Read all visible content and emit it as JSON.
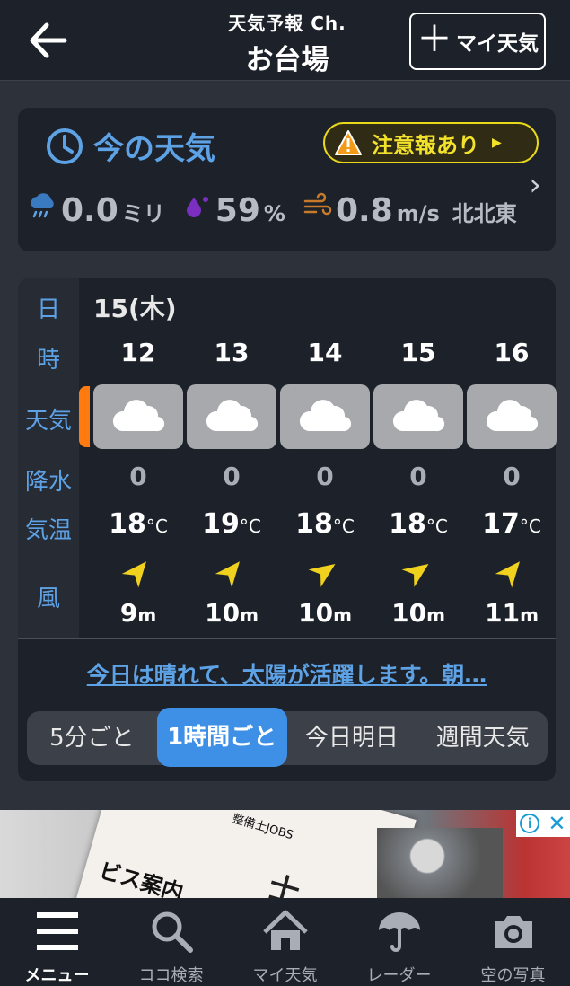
{
  "header": {
    "subtitle": "天気予報 Ch.",
    "title": "お台場",
    "my_weather_button": "マイ天気"
  },
  "now": {
    "title": "今の天気",
    "alert_label": "注意報あり",
    "precip_value": "0.0",
    "precip_unit": "ミリ",
    "humidity_value": "59",
    "humidity_unit": "%",
    "wind_value": "0.8",
    "wind_unit": "m/s",
    "wind_dir": "北北東"
  },
  "forecast": {
    "labels": {
      "day": "日",
      "hour": "時",
      "weather": "天気",
      "precip": "降水",
      "temp": "気温",
      "wind": "風"
    },
    "date": "15(木)",
    "hours": [
      {
        "hour": "12",
        "weather": "cloudy-icon",
        "precip": "0",
        "temp": "18",
        "wind_speed": "9",
        "wind_dir_deg": 40
      },
      {
        "hour": "13",
        "weather": "cloudy-icon",
        "precip": "0",
        "temp": "19",
        "wind_speed": "10",
        "wind_dir_deg": 40
      },
      {
        "hour": "14",
        "weather": "cloudy-icon",
        "precip": "0",
        "temp": "18",
        "wind_speed": "10",
        "wind_dir_deg": 55
      },
      {
        "hour": "15",
        "weather": "cloudy-icon",
        "precip": "0",
        "temp": "18",
        "wind_speed": "10",
        "wind_dir_deg": 55
      },
      {
        "hour": "16",
        "weather": "cloudy-icon",
        "precip": "0",
        "temp": "17",
        "wind_speed": "11",
        "wind_dir_deg": 40
      }
    ],
    "temp_unit": "°C",
    "wind_unit": "m",
    "summary": "今日は晴れて、太陽が活躍します。朝…"
  },
  "segments": {
    "items": [
      "5分ごと",
      "1時間ごと",
      "今日明日",
      "週間天気"
    ],
    "active_index": 1
  },
  "ad": {
    "tag": "整備士JOBS",
    "text1": "ビス案内",
    "text2": "士"
  },
  "nav": {
    "items": [
      {
        "label": "メニュー",
        "icon": "menu-icon",
        "active": true
      },
      {
        "label": "ココ検索",
        "icon": "search-icon",
        "active": false
      },
      {
        "label": "マイ天気",
        "icon": "home-icon",
        "active": false
      },
      {
        "label": "レーダー",
        "icon": "umbrella-icon",
        "active": false
      },
      {
        "label": "空の写真",
        "icon": "camera-icon",
        "active": false
      }
    ]
  },
  "colors": {
    "accent_blue": "#5ea2e6",
    "alert_yellow": "#f3e22b",
    "active_tab": "#3e8fe6",
    "orange_marker": "#ff7b0f"
  }
}
